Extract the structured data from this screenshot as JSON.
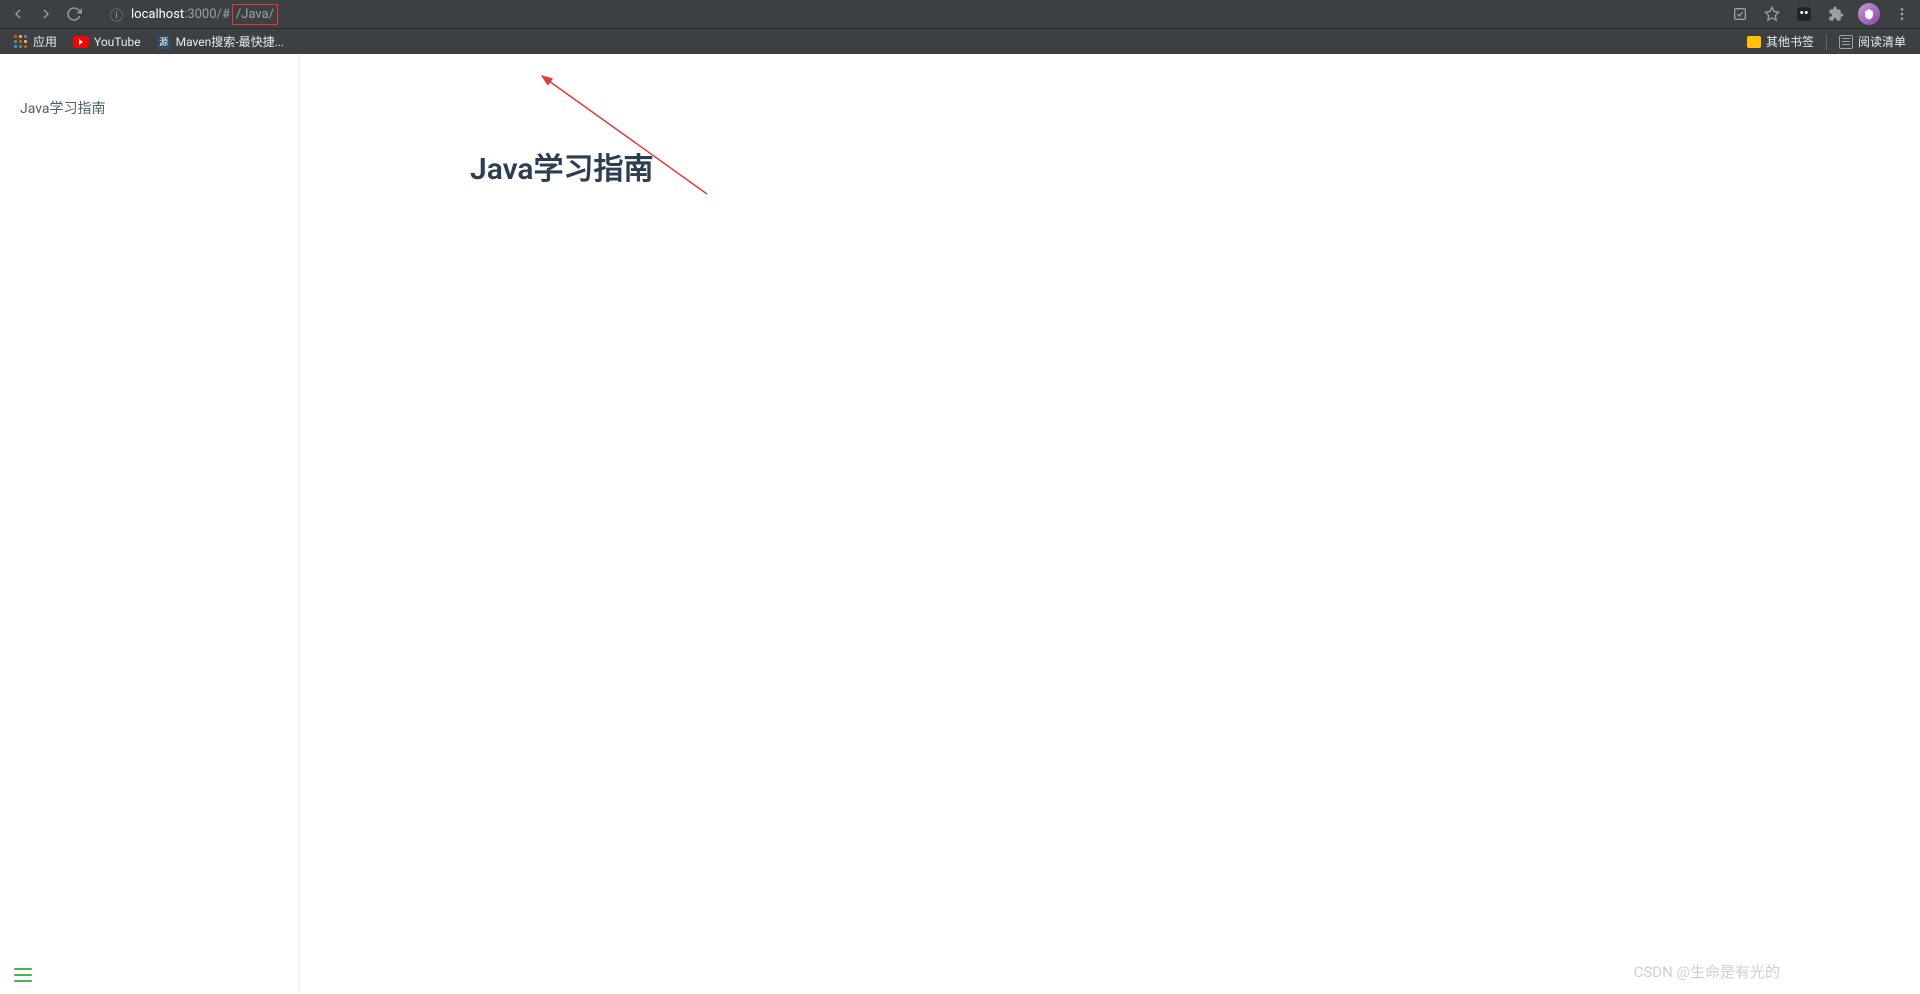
{
  "browser": {
    "url_host": "localhost",
    "url_port": ":3000",
    "url_path_prefix": "/#",
    "url_path_highlighted": "/Java/"
  },
  "bookmarks_bar": {
    "apps": "应用",
    "youtube": "YouTube",
    "maven": "Maven搜索-最快捷...",
    "other_bookmarks": "其他书签",
    "reading_list": "阅读清单"
  },
  "sidebar": {
    "items": [
      {
        "label": "Java学习指南"
      }
    ]
  },
  "main": {
    "heading": "Java学习指南"
  },
  "watermark": "CSDN @生命是有光的"
}
